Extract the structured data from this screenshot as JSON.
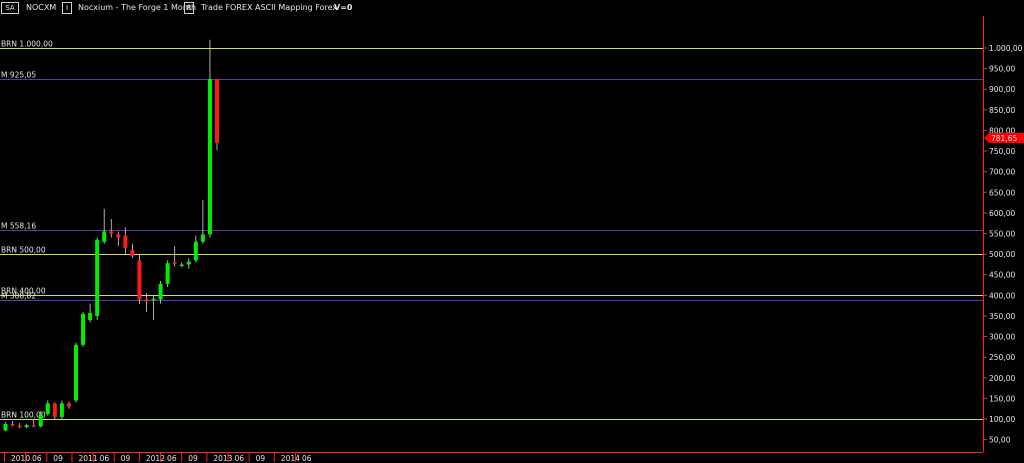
{
  "toolbar": {
    "symbol_button": "SA",
    "symbol": "NOCXM",
    "instrument_button": "I",
    "instrument_title": "Nocxium - The Forge  1 Month",
    "range_button": "R",
    "info": "Trade  FOREX  ASCII Mapping  Forex",
    "volume": "V=0"
  },
  "colors": {
    "background": "#000000",
    "up_candle": "#00ee00",
    "down_candle": "#ff1a1a",
    "brn_line": "#d8d858",
    "m_line": "#5a3aa8",
    "axis": "#ff2020",
    "price_marker": "#ff0000"
  },
  "chart_data": {
    "type": "candlestick",
    "title": "",
    "ylim": [
      30,
      1060
    ],
    "y_ticks": [
      "50,00",
      "100,00",
      "150,00",
      "200,00",
      "250,00",
      "300,00",
      "350,00",
      "400,00",
      "450,00",
      "500,00",
      "550,00",
      "600,00",
      "650,00",
      "700,00",
      "750,00",
      "800,00",
      "850,00",
      "900,00",
      "950,00",
      "1.000,00"
    ],
    "x_labels": [
      "2010",
      "06",
      "09",
      "2011",
      "06",
      "09",
      "2012",
      "06",
      "09",
      "2013",
      "06",
      "09",
      "2014",
      "06"
    ],
    "current_price_label": "781,65",
    "current_price": 781.65,
    "levels": [
      {
        "label": "BRN 1.000,00",
        "value": 1000,
        "kind": "brn"
      },
      {
        "label": "M 925,05",
        "value": 925.05,
        "kind": "m"
      },
      {
        "label": "M 558,16",
        "value": 558.16,
        "kind": "m"
      },
      {
        "label": "BRN 500,00",
        "value": 500,
        "kind": "brn"
      },
      {
        "label": "BRN 400,00",
        "value": 400,
        "kind": "brn"
      },
      {
        "label": "M 388,82",
        "value": 388.82,
        "kind": "m"
      },
      {
        "label": "BRN 100,00",
        "value": 100,
        "kind": "brn"
      }
    ],
    "candles": [
      {
        "o": 72,
        "h": 92,
        "l": 70,
        "c": 88
      },
      {
        "o": 88,
        "h": 95,
        "l": 82,
        "c": 84
      },
      {
        "o": 84,
        "h": 90,
        "l": 78,
        "c": 80
      },
      {
        "o": 80,
        "h": 88,
        "l": 78,
        "c": 85
      },
      {
        "o": 85,
        "h": 98,
        "l": 80,
        "c": 82
      },
      {
        "o": 82,
        "h": 120,
        "l": 80,
        "c": 112
      },
      {
        "o": 112,
        "h": 145,
        "l": 108,
        "c": 138
      },
      {
        "o": 138,
        "h": 140,
        "l": 100,
        "c": 105
      },
      {
        "o": 105,
        "h": 145,
        "l": 100,
        "c": 138
      },
      {
        "o": 138,
        "h": 142,
        "l": 125,
        "c": 130
      },
      {
        "o": 145,
        "h": 285,
        "l": 140,
        "c": 280
      },
      {
        "o": 280,
        "h": 360,
        "l": 275,
        "c": 355
      },
      {
        "o": 340,
        "h": 380,
        "l": 335,
        "c": 357
      },
      {
        "o": 350,
        "h": 540,
        "l": 340,
        "c": 535
      },
      {
        "o": 530,
        "h": 610,
        "l": 525,
        "c": 555
      },
      {
        "o": 555,
        "h": 585,
        "l": 540,
        "c": 550
      },
      {
        "o": 548,
        "h": 555,
        "l": 520,
        "c": 540
      },
      {
        "o": 545,
        "h": 565,
        "l": 500,
        "c": 515
      },
      {
        "o": 510,
        "h": 525,
        "l": 490,
        "c": 495
      },
      {
        "o": 485,
        "h": 500,
        "l": 380,
        "c": 390
      },
      {
        "o": 390,
        "h": 405,
        "l": 360,
        "c": 385
      },
      {
        "o": 388,
        "h": 400,
        "l": 340,
        "c": 392
      },
      {
        "o": 390,
        "h": 435,
        "l": 380,
        "c": 428
      },
      {
        "o": 428,
        "h": 485,
        "l": 420,
        "c": 478
      },
      {
        "o": 480,
        "h": 520,
        "l": 470,
        "c": 478
      },
      {
        "o": 472,
        "h": 480,
        "l": 468,
        "c": 475
      },
      {
        "o": 475,
        "h": 490,
        "l": 465,
        "c": 482
      },
      {
        "o": 485,
        "h": 545,
        "l": 480,
        "c": 530
      },
      {
        "o": 530,
        "h": 632,
        "l": 525,
        "c": 548
      },
      {
        "o": 548,
        "h": 1020,
        "l": 540,
        "c": 925
      },
      {
        "o": 925,
        "h": 925,
        "l": 752,
        "c": 770
      }
    ]
  }
}
